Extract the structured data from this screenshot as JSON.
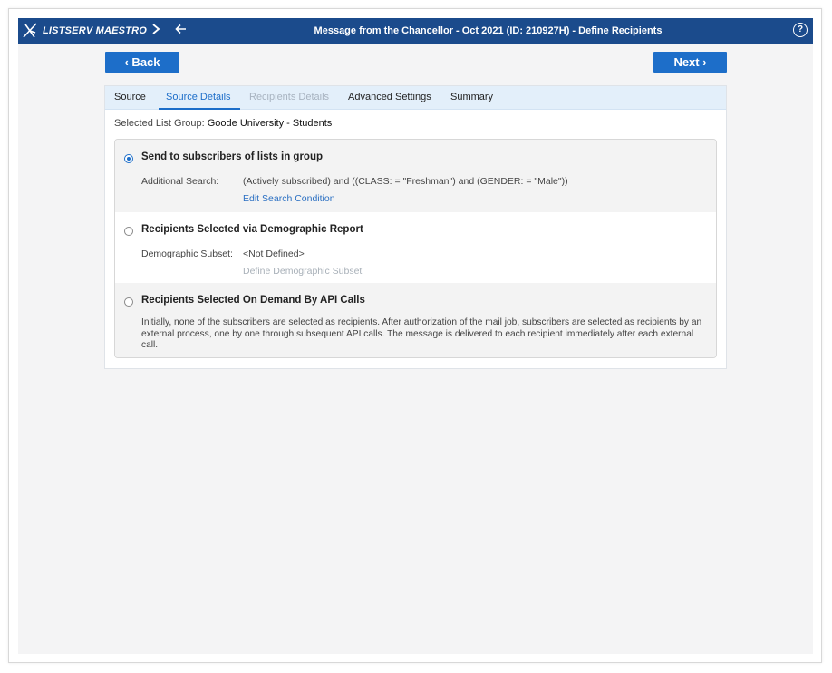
{
  "app": {
    "brand": "LISTSERV MAESTRO",
    "window_title": "Message from the Chancellor - Oct 2021 (ID: 210927H) - Define Recipients",
    "help_icon": "help-icon",
    "forward_icon": "chevron-right-icon",
    "back_icon": "arrow-left-icon",
    "accent_color": "#1b4b8c",
    "button_color": "#1d6ec9"
  },
  "buttons": {
    "back": "‹ Back",
    "next": "Next ›"
  },
  "tabs": [
    {
      "label": "Source",
      "state": "normal"
    },
    {
      "label": "Source Details",
      "state": "active"
    },
    {
      "label": "Recipients Details",
      "state": "disabled"
    },
    {
      "label": "Advanced Settings",
      "state": "normal"
    },
    {
      "label": "Summary",
      "state": "normal"
    }
  ],
  "list_group": {
    "label": "Selected List Group:",
    "value": "Goode University - Students"
  },
  "options": [
    {
      "title": "Send to subscribers of lists in group",
      "selected": true,
      "field_label": "Additional Search:",
      "field_value": "(Actively subscribed) and ((CLASS: = \"Freshman\") and (GENDER: = \"Male\"))",
      "link": "Edit Search Condition"
    },
    {
      "title": "Recipients Selected via Demographic Report",
      "selected": false,
      "field_label": "Demographic Subset:",
      "field_value": "<Not Defined>",
      "link": "Define Demographic Subset"
    },
    {
      "title": "Recipients Selected On Demand By API Calls",
      "selected": false,
      "description": "Initially, none of the subscribers are selected as recipients. After authorization of the mail job, subscribers are selected as recipients by an external process, one by one through subsequent API calls. The message is delivered to each recipient immediately after each external call."
    }
  ]
}
